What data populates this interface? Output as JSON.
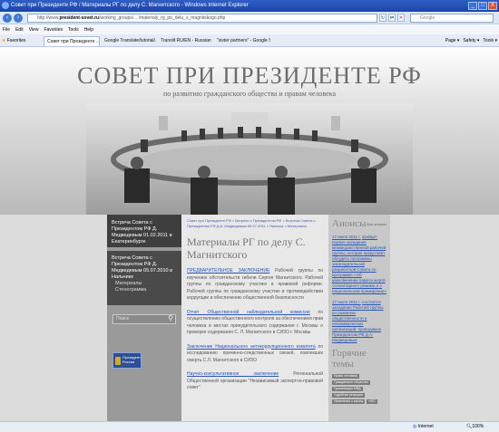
{
  "window": {
    "title": "Совет при Президенте РФ / Материалы РГ по делу С. Магнитского - Windows Internet Explorer",
    "url_prefix": "http://www.",
    "url_host": "president-sovet.ru",
    "url_path": "/working_groups/... /materialy_rg_po_delu_s_magnitskogo.php",
    "search_placeholder": "Google",
    "minimize": "_",
    "maximize": "□",
    "close": "X"
  },
  "menu": [
    "File",
    "Edit",
    "View",
    "Favorites",
    "Tools",
    "Help"
  ],
  "favorites_label": "Favorites",
  "tabs": [
    "Совет при Президенте ...",
    "Google Translate/tutorial/...",
    "Translit RU/EN - Russian Tra...",
    "\"sister partners\" - Google S..."
  ],
  "toolbar": [
    "Page ▾",
    "Safety ▾",
    "Tools ▾"
  ],
  "site": {
    "title": "СОВЕТ ПРИ ПРЕЗИДЕНТЕ РФ",
    "subtitle": "по развитию гражданского общества и правам человека"
  },
  "left": {
    "news1": "Встреча Совета с Президентом РФ Д. Медведевым 01.02.2011 в Екатеринбурге",
    "news2": "Встреча Совета с Президентом РФ Д. Медведевым 05.07.2010 в Нальчике",
    "news2_sub1": "Материалы",
    "news2_sub2": "Стенограмма",
    "search_placeholder": "Поиск",
    "president_label": "Президент России"
  },
  "main": {
    "breadcrumb": "Совет при Президенте РФ > Встречи с Президентом РФ > Встреча Совета с Президентом РФ Д.А. Медведевым 05.07.2011 г. Нальчик > Материалы",
    "title": "Материалы РГ по делу С. Магнитского",
    "p1_link": "ПРЕДВАРИТЕЛЬНОЕ ЗАКЛЮЧЕНИЕ",
    "p1_text": "Рабочей группы по изучению обстоятельств гибели Сергея Магнитского. Рабочей группы по гражданскому участию в правовой реформе. Рабочей группы по гражданскому участию в противодействии коррупции и обеспечению общественной безопасности",
    "p2_link": "Отчет Общественной наблюдательной комиссии",
    "p2_text": "по осуществлению общественного контроля за обеспечением прав человека в местах принудительного содержания г. Москвы о проверке содержания С. Л. Магнитского в СИЗО г. Москвы",
    "p3_link": "Заключение Национального антикоррупционного комитета",
    "p3_text": "по исследованию причинно-следственных связей, повлекших смерть С.Л. Магнитского в СИЗО",
    "p4_link": "Научно-консультативное заключение",
    "p4_text": "Региональной Общественной организации \"Независимый экспертно-правовой совет\""
  },
  "right": {
    "heading": "Анонсы",
    "all_link": "Все анонсы",
    "ann1_date": "17 июля 2011 г.",
    "ann1_text": "пройдет первое заседание межведомственной рабочей группы, которая представит обсудить программы законодательной разработкой Совета по программе «Об увековечении памяти жертв тоталитарного режима и о национальном примирении»",
    "ann2_date": "17 июля 2011 г.",
    "ann2_text": "состоится заседание Рабочей группы по развитию общественности и некоммерческих организаций, проводимое Президентом РФ Д.А. Медведевым",
    "tags_heading": "Горячие темы",
    "tags": [
      "Права человека",
      "Гражданское общество",
      "Гуманизация МВД",
      "Судебная реформа",
      "Изменения к закону",
      "НКО"
    ]
  },
  "status": {
    "zone": "Internet",
    "zoom": "100%"
  }
}
